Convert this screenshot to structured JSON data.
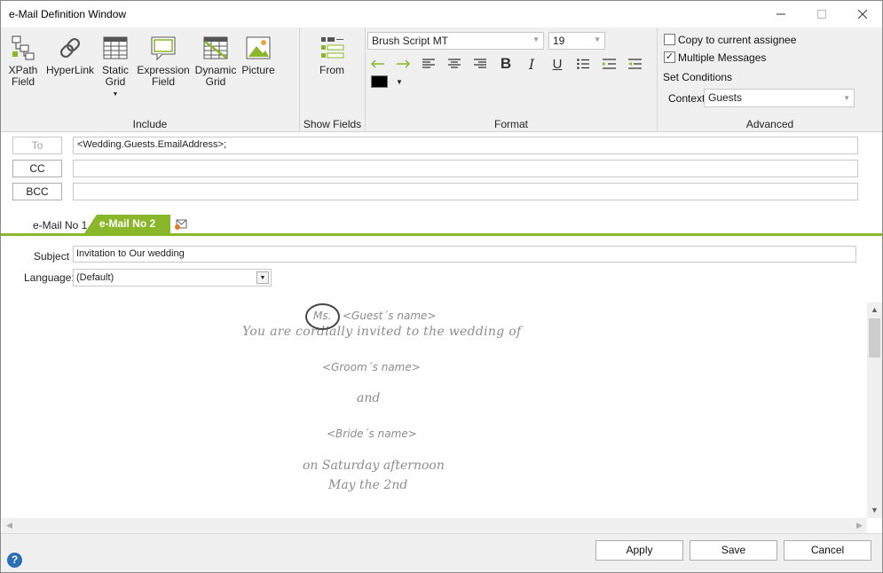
{
  "window": {
    "title": "e-Mail Definition Window"
  },
  "ribbon": {
    "include": {
      "label": "Include",
      "buttons": [
        {
          "label": "XPath\nField",
          "icon": "xpath-field-icon"
        },
        {
          "label": "HyperLink",
          "icon": "hyperlink-icon"
        },
        {
          "label": "Static\nGrid",
          "icon": "static-grid-icon"
        },
        {
          "label": "Expression\nField",
          "icon": "expression-field-icon"
        },
        {
          "label": "Dynamic\nGrid",
          "icon": "dynamic-grid-icon"
        },
        {
          "label": "Picture",
          "icon": "picture-icon"
        }
      ]
    },
    "show_fields": {
      "label": "Show Fields",
      "from_label": "From"
    },
    "format": {
      "label": "Format",
      "font_family": "Brush Script MT",
      "font_size": "19",
      "text_color": "#000000"
    },
    "advanced": {
      "label": "Advanced",
      "copy_to_assignee": "Copy to current assignee",
      "copy_checked": false,
      "multiple_messages": "Multiple Messages",
      "multiple_checked": true,
      "set_conditions": "Set Conditions",
      "context_label": "Context",
      "context_value": "Guests"
    }
  },
  "address": {
    "to_label": "To",
    "to_value": "<Wedding.Guests.EmailAddress>;",
    "cc_label": "CC",
    "cc_value": "",
    "bcc_label": "BCC",
    "bcc_value": ""
  },
  "tabs": [
    {
      "label": "e-Mail No  1",
      "active": false
    },
    {
      "label": "e-Mail No 2",
      "active": true
    }
  ],
  "message": {
    "subject_label": "Subject",
    "subject_value": "Invitation to Our wedding",
    "language_label": "Language:",
    "language_value": "(Default)"
  },
  "body": {
    "salutation": "Ms.",
    "guest_name": "<Guest´s name>",
    "line1": "You are cordially invited to the wedding of",
    "groom": "<Groom´s name>",
    "and": "and",
    "bride": "<Bride´s name>",
    "line2": "on Saturday afternoon",
    "line3": "May the 2nd"
  },
  "footer": {
    "apply": "Apply",
    "save": "Save",
    "cancel": "Cancel",
    "help": "?"
  },
  "colors": {
    "accent_green": "#8ab62a",
    "help_blue": "#2a6fb6"
  }
}
